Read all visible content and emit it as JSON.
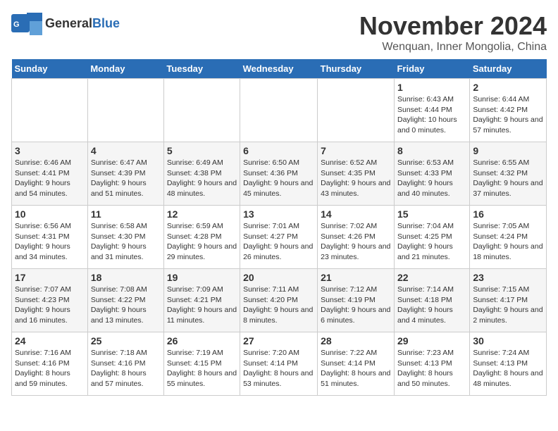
{
  "logo": {
    "general": "General",
    "blue": "Blue"
  },
  "title": "November 2024",
  "location": "Wenquan, Inner Mongolia, China",
  "headers": [
    "Sunday",
    "Monday",
    "Tuesday",
    "Wednesday",
    "Thursday",
    "Friday",
    "Saturday"
  ],
  "weeks": [
    [
      {
        "day": "",
        "info": ""
      },
      {
        "day": "",
        "info": ""
      },
      {
        "day": "",
        "info": ""
      },
      {
        "day": "",
        "info": ""
      },
      {
        "day": "",
        "info": ""
      },
      {
        "day": "1",
        "info": "Sunrise: 6:43 AM\nSunset: 4:44 PM\nDaylight: 10 hours and 0 minutes."
      },
      {
        "day": "2",
        "info": "Sunrise: 6:44 AM\nSunset: 4:42 PM\nDaylight: 9 hours and 57 minutes."
      }
    ],
    [
      {
        "day": "3",
        "info": "Sunrise: 6:46 AM\nSunset: 4:41 PM\nDaylight: 9 hours and 54 minutes."
      },
      {
        "day": "4",
        "info": "Sunrise: 6:47 AM\nSunset: 4:39 PM\nDaylight: 9 hours and 51 minutes."
      },
      {
        "day": "5",
        "info": "Sunrise: 6:49 AM\nSunset: 4:38 PM\nDaylight: 9 hours and 48 minutes."
      },
      {
        "day": "6",
        "info": "Sunrise: 6:50 AM\nSunset: 4:36 PM\nDaylight: 9 hours and 45 minutes."
      },
      {
        "day": "7",
        "info": "Sunrise: 6:52 AM\nSunset: 4:35 PM\nDaylight: 9 hours and 43 minutes."
      },
      {
        "day": "8",
        "info": "Sunrise: 6:53 AM\nSunset: 4:33 PM\nDaylight: 9 hours and 40 minutes."
      },
      {
        "day": "9",
        "info": "Sunrise: 6:55 AM\nSunset: 4:32 PM\nDaylight: 9 hours and 37 minutes."
      }
    ],
    [
      {
        "day": "10",
        "info": "Sunrise: 6:56 AM\nSunset: 4:31 PM\nDaylight: 9 hours and 34 minutes."
      },
      {
        "day": "11",
        "info": "Sunrise: 6:58 AM\nSunset: 4:30 PM\nDaylight: 9 hours and 31 minutes."
      },
      {
        "day": "12",
        "info": "Sunrise: 6:59 AM\nSunset: 4:28 PM\nDaylight: 9 hours and 29 minutes."
      },
      {
        "day": "13",
        "info": "Sunrise: 7:01 AM\nSunset: 4:27 PM\nDaylight: 9 hours and 26 minutes."
      },
      {
        "day": "14",
        "info": "Sunrise: 7:02 AM\nSunset: 4:26 PM\nDaylight: 9 hours and 23 minutes."
      },
      {
        "day": "15",
        "info": "Sunrise: 7:04 AM\nSunset: 4:25 PM\nDaylight: 9 hours and 21 minutes."
      },
      {
        "day": "16",
        "info": "Sunrise: 7:05 AM\nSunset: 4:24 PM\nDaylight: 9 hours and 18 minutes."
      }
    ],
    [
      {
        "day": "17",
        "info": "Sunrise: 7:07 AM\nSunset: 4:23 PM\nDaylight: 9 hours and 16 minutes."
      },
      {
        "day": "18",
        "info": "Sunrise: 7:08 AM\nSunset: 4:22 PM\nDaylight: 9 hours and 13 minutes."
      },
      {
        "day": "19",
        "info": "Sunrise: 7:09 AM\nSunset: 4:21 PM\nDaylight: 9 hours and 11 minutes."
      },
      {
        "day": "20",
        "info": "Sunrise: 7:11 AM\nSunset: 4:20 PM\nDaylight: 9 hours and 8 minutes."
      },
      {
        "day": "21",
        "info": "Sunrise: 7:12 AM\nSunset: 4:19 PM\nDaylight: 9 hours and 6 minutes."
      },
      {
        "day": "22",
        "info": "Sunrise: 7:14 AM\nSunset: 4:18 PM\nDaylight: 9 hours and 4 minutes."
      },
      {
        "day": "23",
        "info": "Sunrise: 7:15 AM\nSunset: 4:17 PM\nDaylight: 9 hours and 2 minutes."
      }
    ],
    [
      {
        "day": "24",
        "info": "Sunrise: 7:16 AM\nSunset: 4:16 PM\nDaylight: 8 hours and 59 minutes."
      },
      {
        "day": "25",
        "info": "Sunrise: 7:18 AM\nSunset: 4:16 PM\nDaylight: 8 hours and 57 minutes."
      },
      {
        "day": "26",
        "info": "Sunrise: 7:19 AM\nSunset: 4:15 PM\nDaylight: 8 hours and 55 minutes."
      },
      {
        "day": "27",
        "info": "Sunrise: 7:20 AM\nSunset: 4:14 PM\nDaylight: 8 hours and 53 minutes."
      },
      {
        "day": "28",
        "info": "Sunrise: 7:22 AM\nSunset: 4:14 PM\nDaylight: 8 hours and 51 minutes."
      },
      {
        "day": "29",
        "info": "Sunrise: 7:23 AM\nSunset: 4:13 PM\nDaylight: 8 hours and 50 minutes."
      },
      {
        "day": "30",
        "info": "Sunrise: 7:24 AM\nSunset: 4:13 PM\nDaylight: 8 hours and 48 minutes."
      }
    ]
  ]
}
